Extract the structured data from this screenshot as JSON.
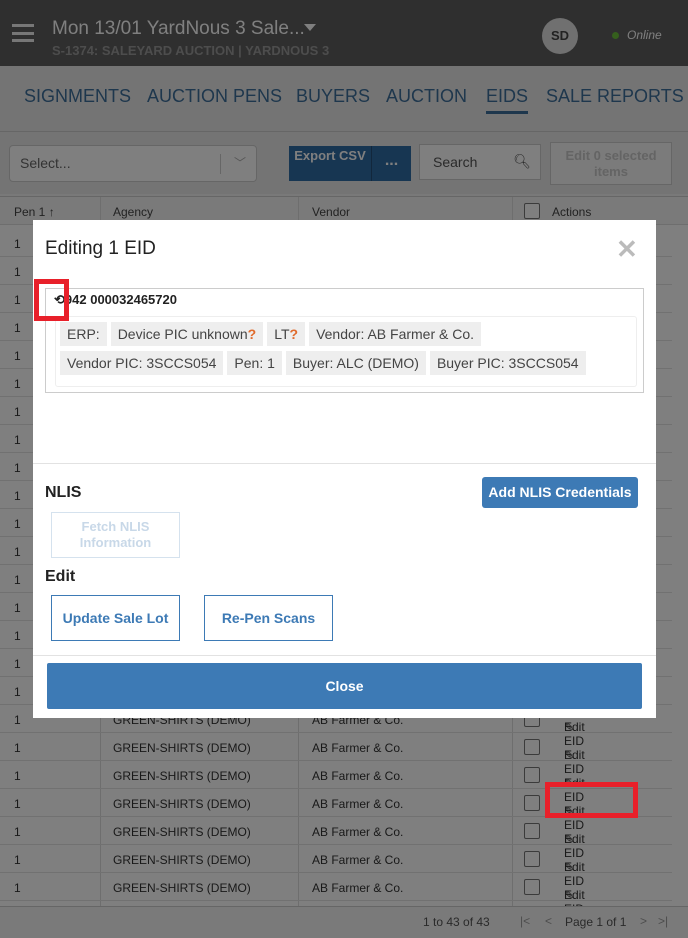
{
  "header": {
    "title": "Mon 13/01 YardNous 3 Sale...",
    "subtitle": "S-1374: SALEYARD AUCTION | YARDNOUS 3",
    "avatar": "SD",
    "status": "Online"
  },
  "tabs": [
    {
      "label": "SIGNMENTS"
    },
    {
      "label": "AUCTION PENS"
    },
    {
      "label": "BUYERS"
    },
    {
      "label": "AUCTION"
    },
    {
      "label": "EIDS",
      "active": true
    },
    {
      "label": "SALE REPORTS"
    }
  ],
  "toolbar": {
    "select_placeholder": "Select...",
    "export": "Export CSV",
    "more": "...",
    "search_placeholder": "Search",
    "edit_selected": "Edit 0 selected items"
  },
  "grid": {
    "columns": [
      "Pen 1 ↑",
      "Agency",
      "Vendor",
      "Actions"
    ],
    "rows": [
      {
        "pen": "1"
      },
      {
        "pen": "1"
      },
      {
        "pen": "1"
      },
      {
        "pen": "1"
      },
      {
        "pen": "1"
      },
      {
        "pen": "1"
      },
      {
        "pen": "1"
      },
      {
        "pen": "1"
      },
      {
        "pen": "1"
      },
      {
        "pen": "1"
      },
      {
        "pen": "1"
      },
      {
        "pen": "1"
      },
      {
        "pen": "1"
      },
      {
        "pen": "1"
      },
      {
        "pen": "1"
      },
      {
        "pen": "1"
      },
      {
        "pen": "1"
      },
      {
        "pen": "1",
        "agency": "GREEN-SHIRTS (DEMO)",
        "vendor": "AB Farmer & Co.",
        "action": "Edit EID"
      },
      {
        "pen": "1",
        "agency": "GREEN-SHIRTS (DEMO)",
        "vendor": "AB Farmer & Co.",
        "action": "Edit EID"
      },
      {
        "pen": "1",
        "agency": "GREEN-SHIRTS (DEMO)",
        "vendor": "AB Farmer & Co.",
        "action": "Edit EID"
      },
      {
        "pen": "1",
        "agency": "GREEN-SHIRTS (DEMO)",
        "vendor": "AB Farmer & Co.",
        "action": "Edit EID"
      },
      {
        "pen": "1",
        "agency": "GREEN-SHIRTS (DEMO)",
        "vendor": "AB Farmer & Co.",
        "action": "Edit EID"
      },
      {
        "pen": "1",
        "agency": "GREEN-SHIRTS (DEMO)",
        "vendor": "AB Farmer & Co.",
        "action": "Edit EID"
      },
      {
        "pen": "1",
        "agency": "GREEN-SHIRTS (DEMO)",
        "vendor": "AB Farmer & Co.",
        "action": "Edit EID"
      }
    ]
  },
  "pager": {
    "summary": "1 to 43 of 43",
    "page": "Page 1 of 1"
  },
  "modal": {
    "title": "Editing 1 EID",
    "eid": "942 000032465720",
    "chips": [
      "ERP:",
      "Device PIC unknown",
      "LT",
      "Vendor: AB Farmer & Co.",
      "Vendor PIC: 3SCCS054",
      "Pen: 1",
      "Buyer: ALC (DEMO)",
      "Buyer PIC: 3SCCS054"
    ],
    "nlis_label": "NLIS",
    "add_nlis": "Add NLIS Credentials",
    "fetch_nlis": "Fetch NLIS Information",
    "edit_label": "Edit",
    "update_sale_lot": "Update Sale Lot",
    "re_pen": "Re-Pen Scans",
    "close": "Close"
  },
  "colors": {
    "primary": "#3d7ab5",
    "highlight": "#e8202a",
    "warning": "#e06b2d"
  }
}
